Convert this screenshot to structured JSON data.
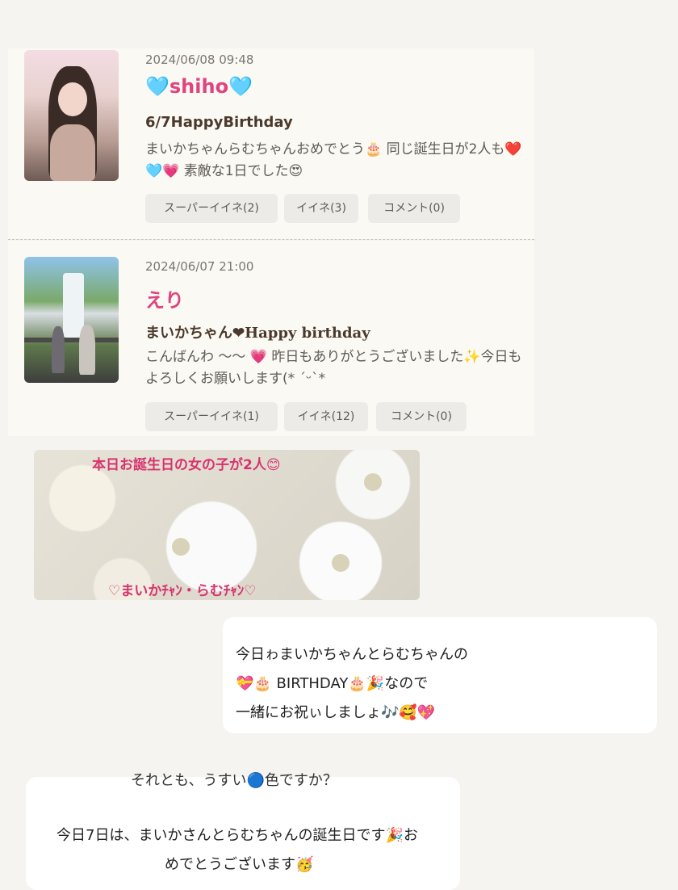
{
  "posts": [
    {
      "date": "2024/06/08 09:48",
      "name": "🩵shiho🩵",
      "title": "6/7HappyBirthday",
      "body": "まいかちゃんらむちゃんおめでとう🎂 同じ誕生日が2人も❤️🩵💗 素敵な1日でした😍",
      "buttons": [
        "スーパーイイネ(2)",
        "イイネ(3)",
        "コメント(0)"
      ]
    },
    {
      "date": "2024/06/07 21:00",
      "name": "えり",
      "title": "まいかちゃん❤Happy birthday",
      "body": "こんばんわ 〜〜 💗 昨日もありがとうございました✨今日もよろしくお願いします(* ´ᵕ`*",
      "buttons": [
        "スーパーイイネ(1)",
        "イイネ(12)",
        "コメント(0)"
      ]
    }
  ],
  "banner": {
    "top_text": "本日お誕生日の女の子が2人😊",
    "bottom_text": "♡まいかﾁｬﾝ・らむﾁｬﾝ♡"
  },
  "bubble1": {
    "line1": "今日ゎまいかちゃんとらむちゃんの",
    "line2": "💝🎂 BIRTHDAY🎂🎉なので",
    "line3": "一緒にお祝ぃしましょ🎶🥰💖"
  },
  "bubble2": {
    "cut_line": "それとも、うすい🔵色ですか？",
    "line1": "今日7日は、まいかさんとらむちゃんの誕生日です🎉お",
    "line2": "めでとうございます🥳"
  }
}
